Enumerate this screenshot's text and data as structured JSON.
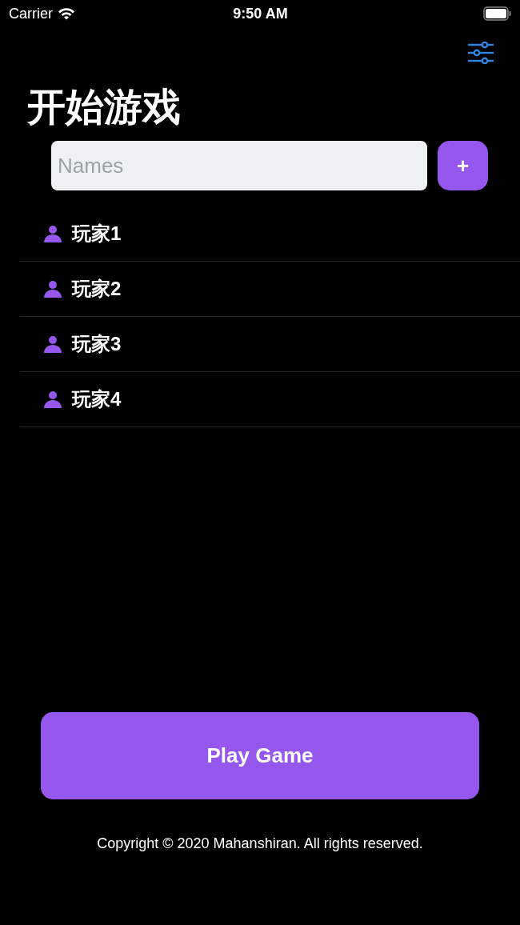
{
  "status_bar": {
    "carrier": "Carrier",
    "time": "9:50 AM"
  },
  "title": "开始游戏",
  "name_field": {
    "placeholder": "Names"
  },
  "add_button": {
    "label": "+"
  },
  "players": [
    {
      "name": "玩家1"
    },
    {
      "name": "玩家2"
    },
    {
      "name": "玩家3"
    },
    {
      "name": "玩家4"
    }
  ],
  "play_button": {
    "label": "Play Game"
  },
  "footer": "Copyright © 2020 Mahanshiran. All rights reserved."
}
